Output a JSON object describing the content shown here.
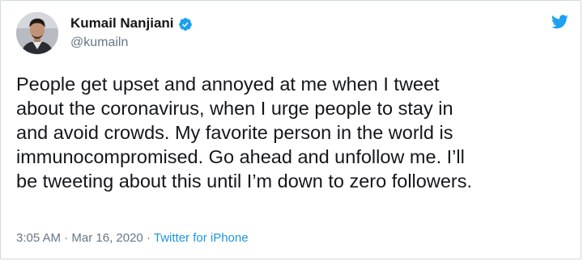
{
  "author": {
    "display_name": "Kumail Nanjiani",
    "handle": "@kumailn",
    "verified": true
  },
  "icons": {
    "verified": "verified-badge-icon",
    "logo": "twitter-bird-icon"
  },
  "tweet": {
    "lines": [
      "People get upset and annoyed at me when I tweet",
      "about the coronavirus, when I urge people to stay in",
      "and avoid crowds. My favorite person in the world is",
      "immunocompromised. Go ahead and unfollow me. I’ll",
      "be tweeting about this until I’m down to zero followers."
    ]
  },
  "meta": {
    "time": "3:05 AM",
    "separator": "·",
    "date": "Mar 16, 2020",
    "source": "Twitter for iPhone"
  },
  "colors": {
    "brand_blue": "#1da1f2",
    "link_blue": "#1b95e0",
    "text": "#14171a",
    "secondary_text": "#657786"
  }
}
